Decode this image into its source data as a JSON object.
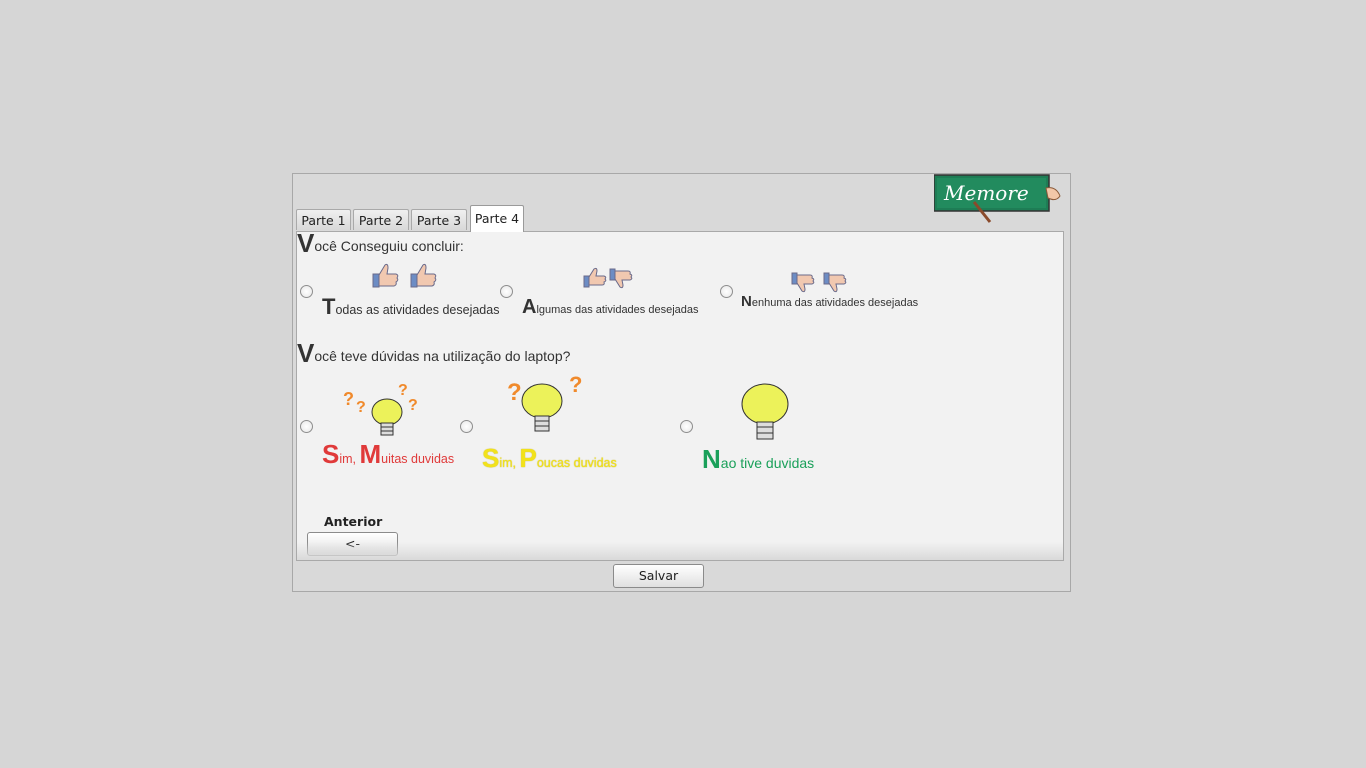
{
  "logo": {
    "text": "Memore"
  },
  "tabs": [
    {
      "label": "Parte 1",
      "active": false
    },
    {
      "label": "Parte 2",
      "active": false
    },
    {
      "label": "Parte 3",
      "active": false
    },
    {
      "label": "Parte 4",
      "active": true
    }
  ],
  "question1": {
    "initial": "V",
    "rest": "ocê Conseguiu  concluir:",
    "options": [
      {
        "initial": "T",
        "rest": "odas as atividades desejadas",
        "color": "#333333"
      },
      {
        "initial": "A",
        "rest": "lgumas das atividades desejadas",
        "color": "#333333"
      },
      {
        "initial": "N",
        "rest": "enhuma das atividades desejadas",
        "color": "#333333"
      }
    ]
  },
  "question2": {
    "initial": "V",
    "rest": "ocê teve dúvidas na utilização do laptop?",
    "options": [
      {
        "initial1": "S",
        "rest1": "im, ",
        "initial2": "M",
        "rest2": "uitas duvidas",
        "color": "#e03a3a"
      },
      {
        "initial1": "S",
        "rest1": "im, ",
        "initial2": "P",
        "rest2": "oucas duvidas",
        "color": "#f2e21b"
      },
      {
        "initial1": "N",
        "rest1": "ao tive duvidas",
        "color": "#1aa05a"
      }
    ]
  },
  "navigation": {
    "previous_label": "Anterior",
    "previous_button": "<-"
  },
  "save_button": "Salvar",
  "colors": {
    "background": "#d6d6d6",
    "panel": "#f2f2f2",
    "logo_green": "#1f8a5a",
    "question_mark": "#f08a2c"
  }
}
